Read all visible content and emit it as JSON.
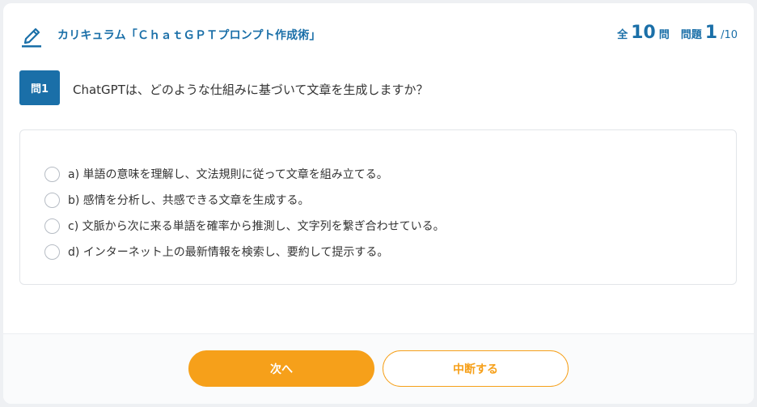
{
  "header": {
    "title": "カリキュラム「ＣｈａｔＧＰＴプロンプト作成術」",
    "icon": "pencil-icon",
    "counter": {
      "total_prefix": "全",
      "total": "10",
      "total_suffix": "問",
      "current_prefix": "問題",
      "current": "1",
      "current_suffix": "/10"
    }
  },
  "question": {
    "badge": "問1",
    "text": "ChatGPTは、どのような仕組みに基づいて文章を生成しますか？"
  },
  "options": [
    {
      "label": "a) 単語の意味を理解し、文法規則に従って文章を組み立てる。",
      "selected": false
    },
    {
      "label": "b) 感情を分析し、共感できる文章を生成する。",
      "selected": false
    },
    {
      "label": "c) 文脈から次に来る単語を確率から推測し、文字列を繋ぎ合わせている。",
      "selected": false
    },
    {
      "label": "d) インターネット上の最新情報を検索し、要約して提示する。",
      "selected": false
    }
  ],
  "footer": {
    "next_label": "次へ",
    "suspend_label": "中断する"
  },
  "colors": {
    "primary": "#1a6fa8",
    "accent": "#f6a01a"
  }
}
